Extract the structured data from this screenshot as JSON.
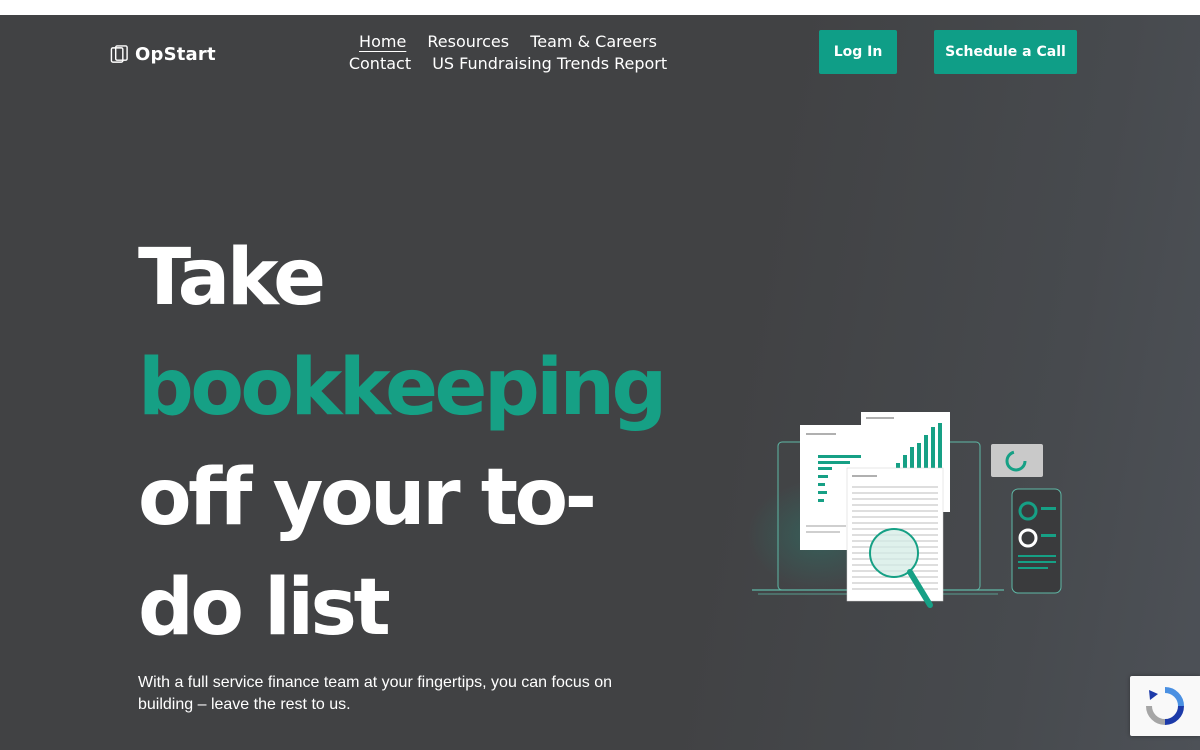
{
  "brand": {
    "name": "OpStart"
  },
  "nav": {
    "items": [
      {
        "label": "Home",
        "active": true
      },
      {
        "label": "Resources"
      },
      {
        "label": "Team & Careers"
      },
      {
        "label": "Contact"
      },
      {
        "label": "US Fundraising Trends Report"
      }
    ]
  },
  "header": {
    "login_label": "Log In",
    "cta_label": "Schedule a Call"
  },
  "hero": {
    "title_line1": "Take",
    "title_line2": "bookkeeping",
    "title_line3": "off your to-",
    "title_line4": "do list",
    "subtitle": "With a full service finance team at your fingertips, you can focus on building – leave the rest to us."
  },
  "colors": {
    "accent": "#16a085",
    "button": "#0f9e87",
    "background": "#414244"
  },
  "icons": {
    "logo": "opstart-logo-icon",
    "illustration": "finance-documents-illustration",
    "recaptcha": "recaptcha-icon"
  }
}
